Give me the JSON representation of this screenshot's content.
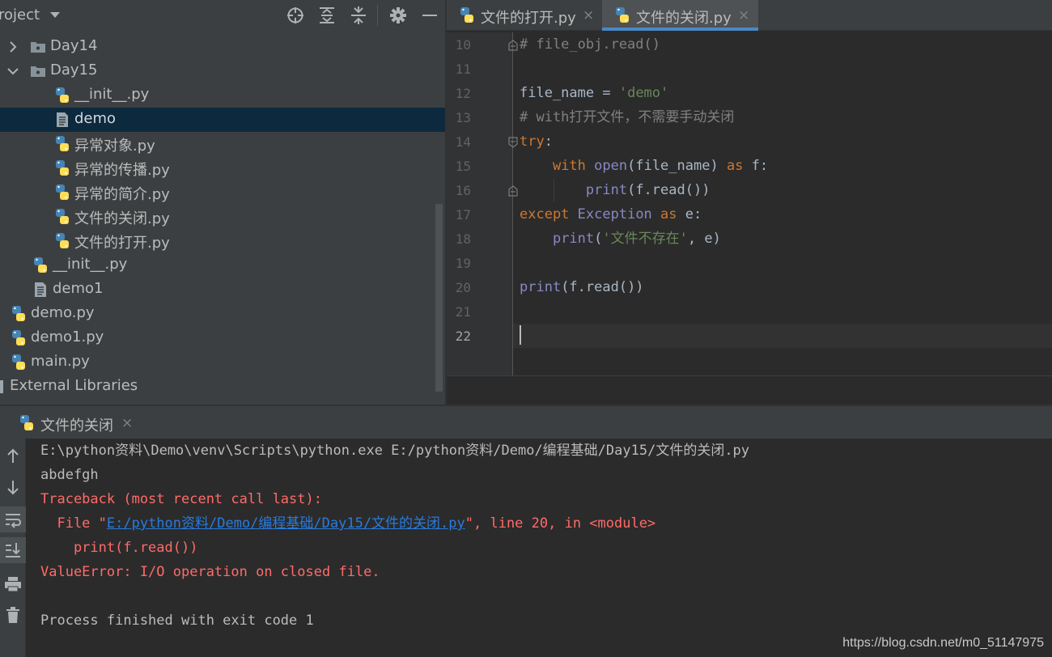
{
  "project": {
    "title": "roject",
    "header_icons": [
      "crosshair-icon",
      "expand-all-icon",
      "collapse-all-icon",
      "gear-icon",
      "minimize-icon"
    ],
    "tree": [
      {
        "label": "Day14",
        "icon": "folder-icon",
        "expand": "chevron-right-icon"
      },
      {
        "label": "Day15",
        "icon": "folder-icon",
        "expand": "chevron-down-icon"
      },
      {
        "label": "__init__.py",
        "icon": "python-file-icon"
      },
      {
        "label": "demo",
        "icon": "text-file-icon"
      },
      {
        "label": "异常对象.py",
        "icon": "python-file-icon"
      },
      {
        "label": "异常的传播.py",
        "icon": "python-file-icon"
      },
      {
        "label": "异常的简介.py",
        "icon": "python-file-icon"
      },
      {
        "label": "文件的关闭.py",
        "icon": "python-file-icon"
      },
      {
        "label": "文件的打开.py",
        "icon": "python-file-icon"
      },
      {
        "label": "__init__.py",
        "icon": "python-file-icon"
      },
      {
        "label": "demo1",
        "icon": "text-file-icon"
      },
      {
        "label": "demo.py",
        "icon": "python-file-icon"
      },
      {
        "label": "demo1.py",
        "icon": "python-file-icon"
      },
      {
        "label": "main.py",
        "icon": "python-file-icon"
      },
      {
        "label": "External Libraries",
        "icon": "library-icon"
      }
    ]
  },
  "editor": {
    "tabs": [
      {
        "label": "文件的打开.py",
        "close": "×",
        "active": false
      },
      {
        "label": "文件的关闭.py",
        "close": "×",
        "active": true
      }
    ],
    "line_numbers": [
      "10",
      "11",
      "12",
      "13",
      "14",
      "15",
      "16",
      "17",
      "18",
      "19",
      "20",
      "21",
      "22"
    ],
    "code": {
      "l10": "# file_obj.read()",
      "l12_name": "file_name",
      "l12_eq": " = ",
      "l12_val": "'demo'",
      "l13": "# with打开文件，不需要手动关闭",
      "l14_kw": "try",
      "l14_colon": ":",
      "l15_with": "with",
      "l15_open": "open",
      "l15_args": "(file_name) ",
      "l15_as": "as",
      "l15_rest": " f:",
      "l16_print": "print",
      "l16_rest": "(f.read())",
      "l17_except": "except",
      "l17_exc": "Exception",
      "l17_as": "as",
      "l17_rest": " e:",
      "l18_print": "print",
      "l18_open": "(",
      "l18_str": "'文件不存在'",
      "l18_rest": ", e)",
      "l20_print": "print",
      "l20_rest": "(f.read())"
    }
  },
  "run": {
    "tab_label": "文件的关闭",
    "tab_close": "×",
    "toolbar": [
      "arrow-up-icon",
      "arrow-down-icon",
      "soft-wrap-icon",
      "scroll-to-end-icon",
      "print-icon",
      "trash-icon"
    ],
    "console": {
      "cmd": "E:\\python资料\\Demo\\venv\\Scripts\\python.exe E:/python资料/Demo/编程基础/Day15/文件的关闭.py",
      "out": "abdefgh",
      "tb": "Traceback (most recent call last):",
      "file_pre": "  File \"",
      "file_link": "E:/python资料/Demo/编程基础/Day15/文件的关闭.py",
      "file_post": "\", line 20, in <module>",
      "code": "    print(f.read())",
      "err": "ValueError: I/O operation on closed file.",
      "exit": "Process finished with exit code 1"
    }
  },
  "watermark": "https://blog.csdn.net/m0_51147975",
  "colors": {
    "accent": "#4a88c7",
    "keyword": "#cc7832",
    "string": "#6a8759",
    "comment": "#808080",
    "builtin": "#8888c6",
    "error": "#ff6b68",
    "link": "#287bde",
    "selection": "#0d293e"
  }
}
